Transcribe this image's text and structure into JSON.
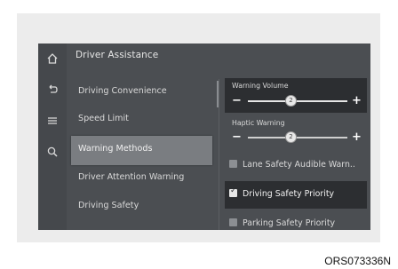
{
  "header": {
    "title": "Driver Assistance"
  },
  "sidebar_icons": [
    "home-icon",
    "back-icon",
    "menu-icon",
    "search-icon"
  ],
  "menu": [
    {
      "label": "Driving Convenience",
      "selected": false
    },
    {
      "label": "Speed Limit",
      "selected": false
    },
    {
      "label": "Warning Methods",
      "selected": true
    },
    {
      "label": "Driver Attention Warning",
      "selected": false
    },
    {
      "label": "Driving Safety",
      "selected": false
    }
  ],
  "settings": {
    "warning_volume": {
      "label": "Warning Volume",
      "value": "2",
      "minus": "−",
      "plus": "+"
    },
    "haptic_warning": {
      "label": "Haptic Warning",
      "value": "2",
      "minus": "−",
      "plus": "+"
    },
    "checkboxes": [
      {
        "label": "Lane Safety Audible Warn..",
        "checked": false
      },
      {
        "label": "Driving Safety Priority",
        "checked": true
      },
      {
        "label": "Parking Safety Priority",
        "checked": false
      }
    ]
  },
  "caption": "ORS073336N"
}
